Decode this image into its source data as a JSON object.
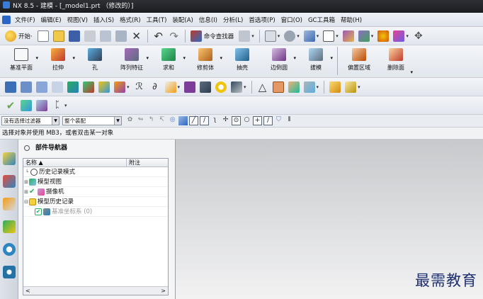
{
  "window": {
    "title": "NX 8.5 - 建模 - [_model1.prt （修改的）]"
  },
  "menu": [
    "文件(F)",
    "编辑(E)",
    "视图(V)",
    "插入(S)",
    "格式(R)",
    "工具(T)",
    "装配(A)",
    "信息(I)",
    "分析(L)",
    "首选项(P)",
    "窗口(O)",
    "GC工具箱",
    "帮助(H)"
  ],
  "standard_toolbar": {
    "start_label": "开始·",
    "command_finder_label": "命令查找器"
  },
  "feature_toolbar": [
    {
      "label": "基准平面",
      "icon": "datum-plane-icon"
    },
    {
      "label": "拉伸",
      "icon": "extrude-icon"
    },
    {
      "label": "孔",
      "icon": "hole-icon"
    },
    {
      "label": "阵列特征",
      "icon": "pattern-feature-icon"
    },
    {
      "label": "求和",
      "icon": "unite-icon"
    },
    {
      "label": "修剪体",
      "icon": "trim-body-icon"
    },
    {
      "label": "抽壳",
      "icon": "shell-icon"
    },
    {
      "label": "边倒圆",
      "icon": "edge-blend-icon"
    },
    {
      "label": "拔模",
      "icon": "draft-icon"
    },
    {
      "label": "偏置区域",
      "icon": "offset-region-icon"
    },
    {
      "label": "删除面",
      "icon": "delete-face-icon"
    }
  ],
  "selection_bar": {
    "filter": "没有选择过滤器",
    "scope": "整个装配"
  },
  "prompt": "选择对象并使用 MB3，或者双击某一对象",
  "navigator": {
    "title": "部件导航器",
    "col_name": "名称 ▲",
    "col_note": "附注",
    "rows": [
      {
        "twisty": "",
        "label": "历史记录模式",
        "dim": false
      },
      {
        "twisty": "⊞",
        "label": "模型视图",
        "dim": false
      },
      {
        "twisty": "⊞",
        "label": "摄像机",
        "dim": false
      },
      {
        "twisty": "⊟",
        "label": "模型历史记录",
        "dim": false
      },
      {
        "twisty": "",
        "label": "基准坐标系 (0)",
        "dim": true
      }
    ],
    "scroll_left": "<",
    "scroll_right": ">"
  },
  "watermark": "最需教育",
  "colors": {
    "titlebar": "#1b1c20",
    "accent": "#2b66c7",
    "canvas_top": "#c7c9cc",
    "canvas_bottom": "#f2f2f3"
  }
}
